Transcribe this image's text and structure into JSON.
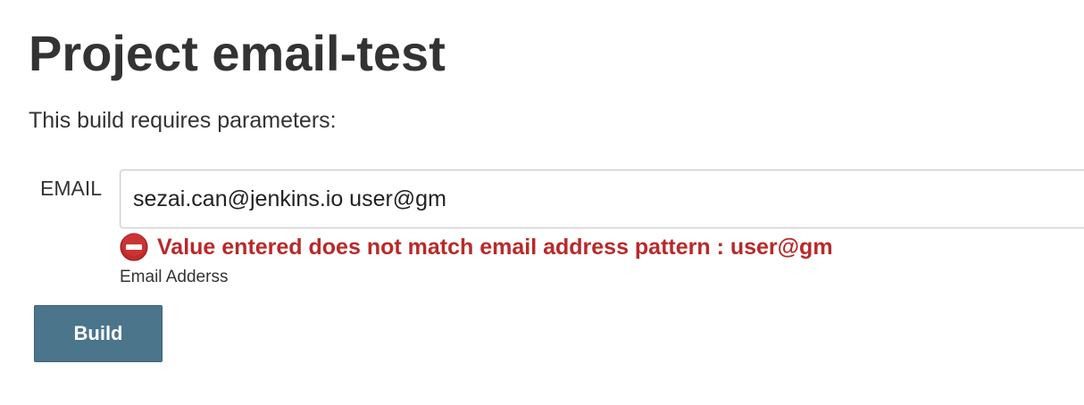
{
  "page": {
    "title": "Project email-test",
    "subtitle": "This build requires parameters:"
  },
  "parameters": [
    {
      "label": "EMAIL",
      "value": "sezai.can@jenkins.io user@gm",
      "error": {
        "icon": "error-icon",
        "message": "Value entered does not match email address pattern : user@gm"
      },
      "description": "Email Adderss"
    }
  ],
  "actions": {
    "build_label": "Build"
  },
  "colors": {
    "text": "#333333",
    "error": "#b92929",
    "button_bg": "#4b758b",
    "button_text": "#ffffff",
    "input_border": "#c7c7c7"
  }
}
